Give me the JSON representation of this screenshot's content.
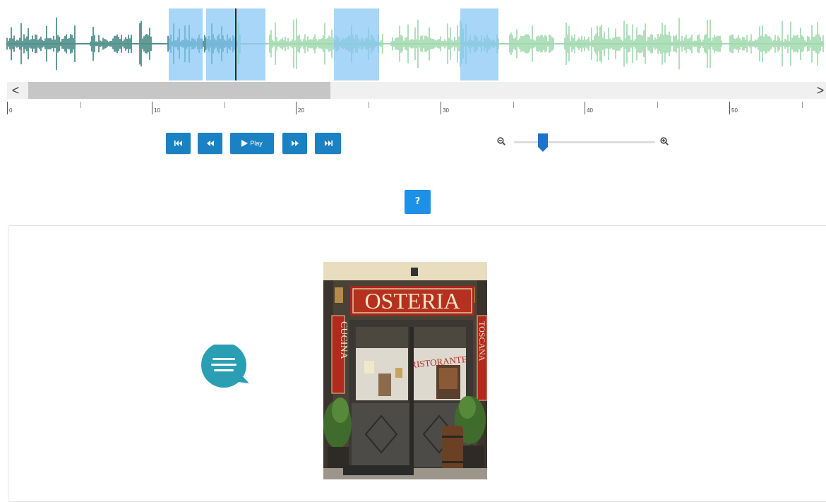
{
  "waveform": {
    "played_color": "#1f6e6b",
    "unplayed_color": "#8fd19e",
    "region_color": "#82c4f5",
    "cursor_color": "#2b2b2b",
    "scroll_left_label": "<",
    "scroll_right_label": ">"
  },
  "timeline": {
    "ticks": [
      "0",
      "10",
      "20",
      "30",
      "40",
      "50"
    ]
  },
  "transport": {
    "skip_back_icon": "skip-to-start-icon",
    "rewind_icon": "rewind-icon",
    "play_label": "Play",
    "forward_icon": "fast-forward-icon",
    "skip_end_icon": "skip-to-end-icon",
    "accent": "#1a82c3"
  },
  "zoom": {
    "zoom_out_icon": "zoom-out-icon",
    "zoom_in_icon": "zoom-in-icon",
    "level": 0.2
  },
  "help": {
    "label": "?",
    "color": "#1e90e6"
  },
  "content": {
    "chat_icon": "speech-bubble-icon",
    "chat_color": "#2a9fb4",
    "photo": {
      "sign_main": "OSTERIA",
      "sign_left": "CUCINA",
      "sign_right": "TOSCANA",
      "window_sign": "RISTORANTE"
    }
  }
}
